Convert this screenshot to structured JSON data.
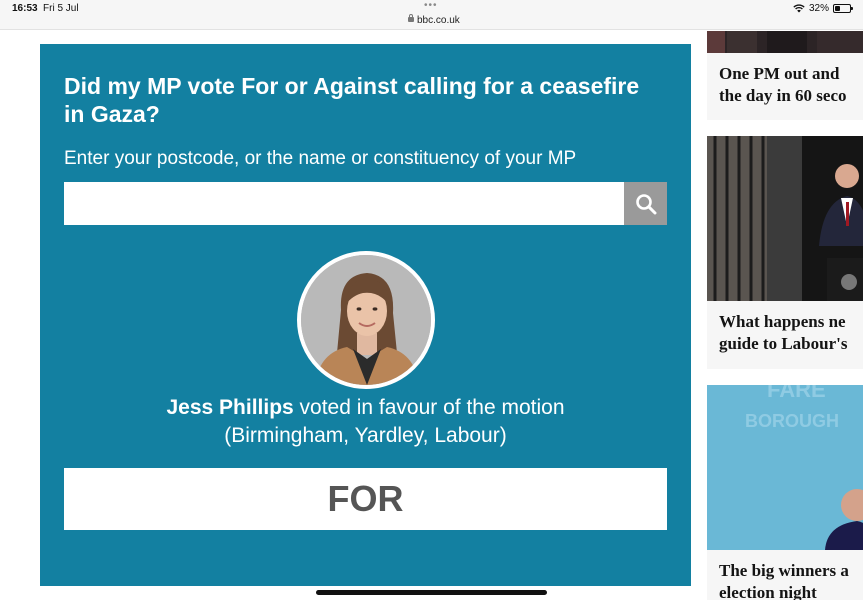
{
  "status_bar": {
    "time": "16:53",
    "date": "Fri 5 Jul",
    "url": "bbc.co.uk",
    "battery": "32%",
    "dots": "•••"
  },
  "panel": {
    "title": "Did my MP vote For or Against calling for a ceasefire in Gaza?",
    "instruction": "Enter your postcode, or the name or constituency of your MP",
    "search_value": "",
    "mp_name": "Jess Phillips",
    "mp_verdict": " voted in favour of the motion",
    "mp_details": "(Birmingham, Yardley, Labour)",
    "vote": "FOR",
    "accent_color": "#1380a1"
  },
  "side_stories": [
    {
      "headline_line1": "One PM out and",
      "headline_line2": "the day in 60 seco"
    },
    {
      "headline_line1": "What happens ne",
      "headline_line2": "guide to Labour's"
    },
    {
      "headline_line1": "The big winners a",
      "headline_line2": "election night",
      "image_text": "BOROUGH"
    }
  ]
}
